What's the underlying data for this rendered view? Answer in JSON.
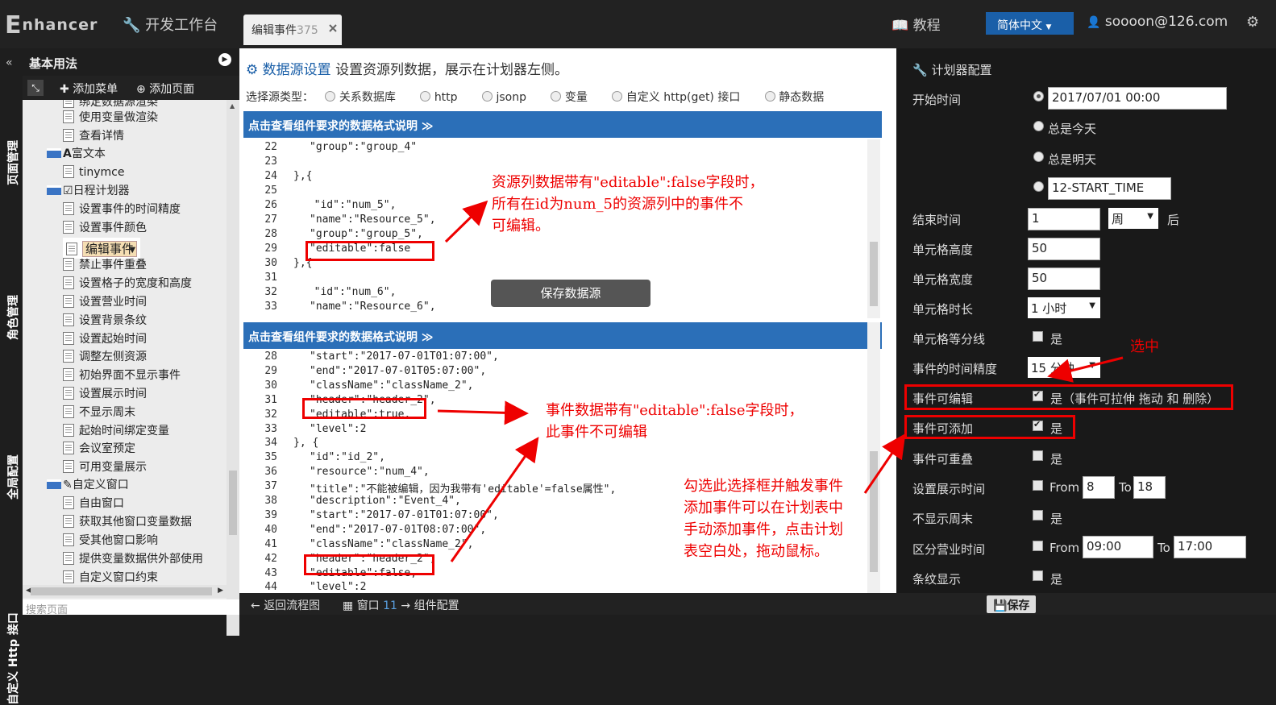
{
  "topbar": {
    "logo": "nhancer",
    "logo_prefix": "E",
    "dev_title": "开发工作台",
    "tab_label": "编辑事件",
    "tab_count": "375",
    "tutorial": "教程",
    "language": "简体中文",
    "user": "soooon@126.com"
  },
  "vtabs": [
    "页面管理",
    "角色管理",
    "全局配置",
    "自定义 Http 接口"
  ],
  "leftpanel": {
    "title": "基本用法",
    "add_menu": "添加菜单",
    "add_page": "添加页面",
    "items": [
      "绑定数据源渲染",
      "使用变量做渲染",
      "查看详情",
      "富文本",
      "tinymce",
      "日程计划器",
      "设置事件的时间精度",
      "设置事件颜色",
      "编辑事件",
      "禁止事件重叠",
      "设置格子的宽度和高度",
      "设置营业时间",
      "设置背景条纹",
      "设置起始时间",
      "调整左侧资源",
      "初始界面不显示事件",
      "设置展示时间",
      "不显示周末",
      "起始时间绑定变量",
      "会议室预定",
      "可用变量展示",
      "自定义窗口",
      "自由窗口",
      "获取其他窗口变量数据",
      "受其他窗口影响",
      "提供变量数据供外部使用",
      "自定义窗口约束"
    ],
    "search": "搜索页面"
  },
  "center": {
    "ds_title": "数据源设置",
    "ds_desc": "设置资源列数据，展示在计划器左侧。",
    "type_label": "选择源类型：",
    "types": [
      "关系数据库",
      "http",
      "jsonp",
      "变量",
      "自定义 http(get) 接口",
      "静态数据"
    ],
    "format_bar": "点击查看组件要求的数据格式说明 ≫",
    "save_btn": "保存数据源",
    "code1": [
      {
        "n": "22",
        "t": "\"group\":\"group_4\""
      },
      {
        "n": "23",
        "t": ""
      },
      {
        "n": "24",
        "t": "},{"
      },
      {
        "n": "25",
        "t": ""
      },
      {
        "n": "26",
        "t": "  \"id\":\"num_5\","
      },
      {
        "n": "27",
        "t": "\"name\":\"Resource_5\","
      },
      {
        "n": "28",
        "t": "\"group\":\"group_5\","
      },
      {
        "n": "29",
        "t": "\"editable\":false"
      },
      {
        "n": "30",
        "t": "},{"
      },
      {
        "n": "31",
        "t": ""
      },
      {
        "n": "32",
        "t": "  \"id\":\"num_6\","
      },
      {
        "n": "33",
        "t": "\"name\":\"Resource_6\","
      }
    ],
    "code2": [
      {
        "n": "28",
        "t": "\"start\":\"2017-07-01T01:07:00\","
      },
      {
        "n": "29",
        "t": "\"end\":\"2017-07-01T05:07:00\","
      },
      {
        "n": "30",
        "t": "\"className\":\"className_2\","
      },
      {
        "n": "31",
        "t": "\"header\":\"header_2\","
      },
      {
        "n": "32",
        "t": "\"editable\":true,"
      },
      {
        "n": "33",
        "t": "\"level\":2"
      },
      {
        "n": "34",
        "t": "}, {"
      },
      {
        "n": "35",
        "t": "\"id\":\"id_2\","
      },
      {
        "n": "36",
        "t": "\"resource\":\"num_4\","
      },
      {
        "n": "37",
        "t": "\"title\":\"不能被编辑，因为我带有'editable'=false属性\","
      },
      {
        "n": "38",
        "t": "\"description\":\"Event_4\","
      },
      {
        "n": "39",
        "t": "\"start\":\"2017-07-01T01:07:00\","
      },
      {
        "n": "40",
        "t": "\"end\":\"2017-07-01T08:07:00\","
      },
      {
        "n": "41",
        "t": "\"className\":\"className_2\","
      },
      {
        "n": "42",
        "t": "\"header\":\"header_2\","
      },
      {
        "n": "43",
        "t": "\"editable\":false,"
      },
      {
        "n": "44",
        "t": "\"level\":2"
      }
    ],
    "annot1": [
      "资源列数据带有\"editable\":false字段时，",
      "所有在id为num_5的资源列中的事件不",
      "可编辑。"
    ],
    "annot2": [
      "事件数据带有\"editable\":false字段时，",
      "此事件不可编辑"
    ],
    "annot3": [
      "勾选此选择框并触发事件",
      "添加事件可以在计划表中",
      "手动添加事件，点击计划",
      "表空白处，拖动鼠标。"
    ],
    "annot_sel": "选中"
  },
  "rightpanel": {
    "title": "计划器配置",
    "start_time": "开始时间",
    "start_value": "2017/07/01  00:00",
    "always_today": "总是今天",
    "always_tomorrow": "总是明天",
    "start_var": "12-START_TIME",
    "end_time": "结束时间",
    "end_value": "1",
    "end_unit": "周",
    "end_after": "后",
    "cell_height": "单元格高度",
    "cell_height_value": "50",
    "cell_width": "单元格宽度",
    "cell_width_value": "50",
    "cell_duration": "单元格时长",
    "cell_duration_value": "1 小时",
    "cell_divider": "单元格等分线",
    "yes": "是",
    "precision": "事件的时间精度",
    "precision_value": "15 分钟",
    "editable": "事件可编辑",
    "editable_desc": "是（事件可拉伸 拖动 和 删除）",
    "addable": "事件可添加",
    "overlap": "事件可重叠",
    "show_time": "设置展示时间",
    "from": "From",
    "to": "To",
    "show_from": "8",
    "show_to": "18",
    "no_weekend": "不显示周末",
    "business": "区分营业时间",
    "business_from": "09:00",
    "business_to": "17:00",
    "stripes": "条纹显示"
  },
  "bottom": {
    "back": "返回流程图",
    "window": "窗口",
    "window_num": "11",
    "component": "组件配置",
    "save": "保存"
  }
}
